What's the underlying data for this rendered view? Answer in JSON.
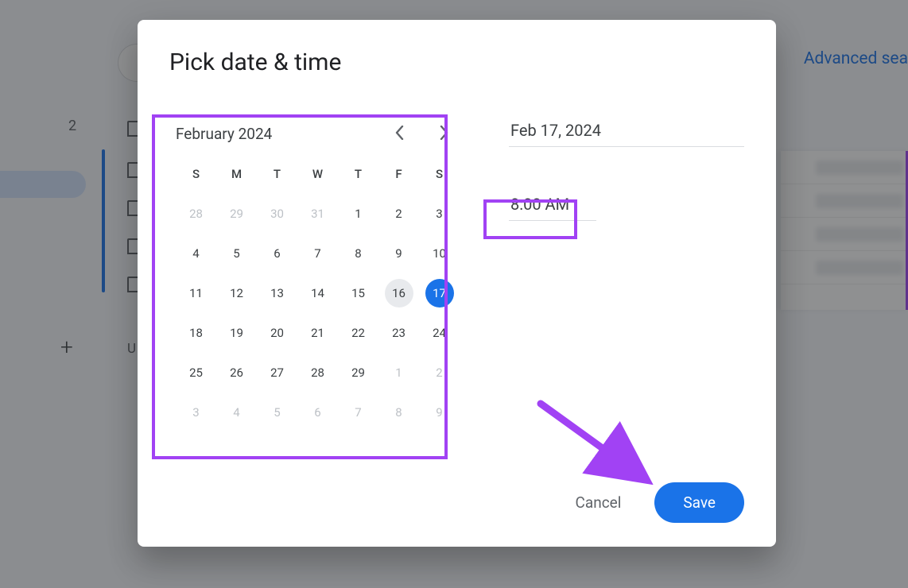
{
  "background": {
    "advanced_search": "Advanced sea",
    "section_number": "2",
    "u_char": "U"
  },
  "dialog": {
    "title": "Pick date & time",
    "calendar": {
      "month_label": "February 2024",
      "dow": [
        "S",
        "M",
        "T",
        "W",
        "T",
        "F",
        "S"
      ],
      "weeks": [
        [
          {
            "n": 28,
            "o": true
          },
          {
            "n": 29,
            "o": true
          },
          {
            "n": 30,
            "o": true
          },
          {
            "n": 31,
            "o": true
          },
          {
            "n": 1
          },
          {
            "n": 2
          },
          {
            "n": 3
          }
        ],
        [
          {
            "n": 4
          },
          {
            "n": 5
          },
          {
            "n": 6
          },
          {
            "n": 7
          },
          {
            "n": 8
          },
          {
            "n": 9
          },
          {
            "n": 10
          }
        ],
        [
          {
            "n": 11
          },
          {
            "n": 12
          },
          {
            "n": 13
          },
          {
            "n": 14
          },
          {
            "n": 15
          },
          {
            "n": 16,
            "today": true
          },
          {
            "n": 17,
            "selected": true
          }
        ],
        [
          {
            "n": 18
          },
          {
            "n": 19
          },
          {
            "n": 20
          },
          {
            "n": 21
          },
          {
            "n": 22
          },
          {
            "n": 23
          },
          {
            "n": 24
          }
        ],
        [
          {
            "n": 25
          },
          {
            "n": 26
          },
          {
            "n": 27
          },
          {
            "n": 28
          },
          {
            "n": 29
          },
          {
            "n": 1,
            "o": true
          },
          {
            "n": 2,
            "o": true
          }
        ],
        [
          {
            "n": 3,
            "o": true
          },
          {
            "n": 4,
            "o": true
          },
          {
            "n": 5,
            "o": true
          },
          {
            "n": 6,
            "o": true
          },
          {
            "n": 7,
            "o": true
          },
          {
            "n": 8,
            "o": true
          },
          {
            "n": 9,
            "o": true
          }
        ]
      ]
    },
    "date_value": "Feb 17, 2024",
    "time_value": "8:00 AM",
    "cancel": "Cancel",
    "save": "Save"
  },
  "annotations": {
    "arrow_color": "#a142f4"
  }
}
